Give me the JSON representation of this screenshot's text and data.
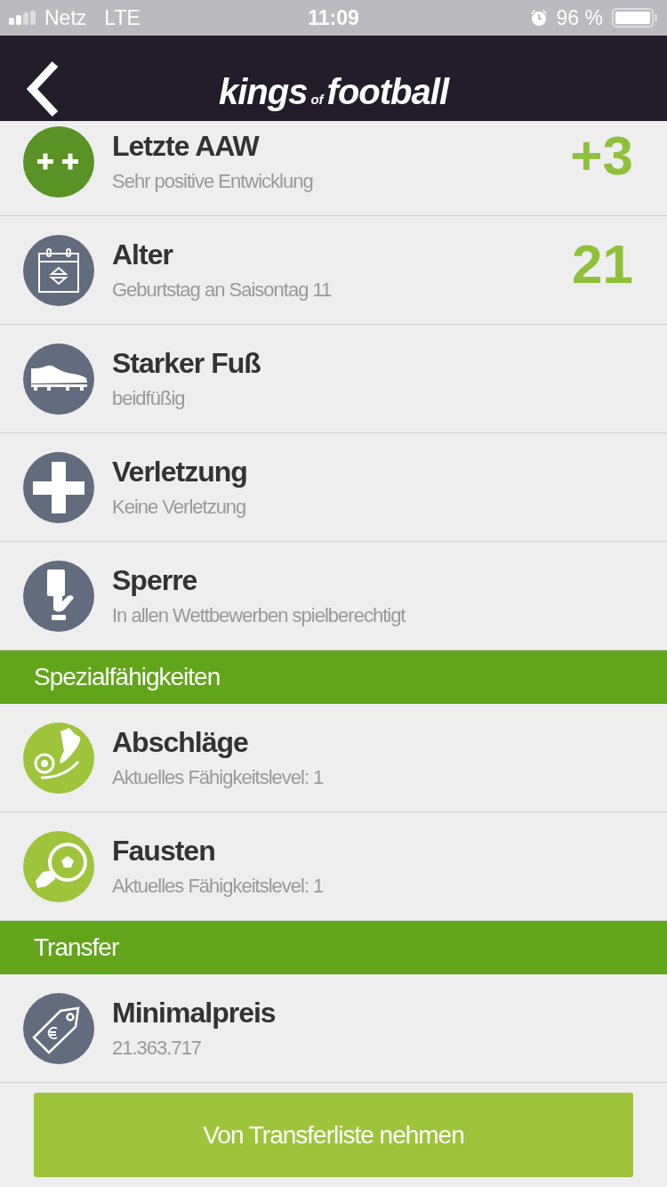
{
  "status_bar": {
    "carrier": "Netz",
    "network": "LTE",
    "time": "11:09",
    "battery": "96 %"
  },
  "header": {
    "logo_main": "kings",
    "logo_small": "of",
    "logo_end": "football"
  },
  "sections": [
    {
      "rows": [
        {
          "kind": "plusplus",
          "color": "#5a9226",
          "title": "Letzte AAW",
          "subtitle": "Sehr positive Entwicklung",
          "value": "+3"
        },
        {
          "kind": "calendar",
          "color": "#636b7e",
          "title": "Alter",
          "subtitle": "Geburtstag an Saisontag 11",
          "value": "21"
        },
        {
          "kind": "shoe",
          "color": "#636b7e",
          "title": "Starker Fuß",
          "subtitle": "beidfüßig"
        },
        {
          "kind": "cross",
          "color": "#636b7e",
          "title": "Verletzung",
          "subtitle": "Keine Verletzung"
        },
        {
          "kind": "card",
          "color": "#636b7e",
          "title": "Sperre",
          "subtitle": "In allen Wettbewerben spielberechtigt"
        }
      ]
    },
    {
      "heading": "Spezialfähigkeiten",
      "rows": [
        {
          "kind": "kick",
          "color": "#9dc43a",
          "title": "Abschläge",
          "subtitle": "Aktuelles Fähigkeitslevel: 1"
        },
        {
          "kind": "punch",
          "color": "#9dc43a",
          "title": "Fausten",
          "subtitle": "Aktuelles Fähigkeitslevel: 1"
        }
      ]
    },
    {
      "heading": "Transfer",
      "rows": [
        {
          "kind": "tag",
          "color": "#636b7e",
          "title": "Minimalpreis",
          "subtitle": "21.363.717"
        }
      ]
    }
  ],
  "action_button": "Von Transferliste nehmen"
}
